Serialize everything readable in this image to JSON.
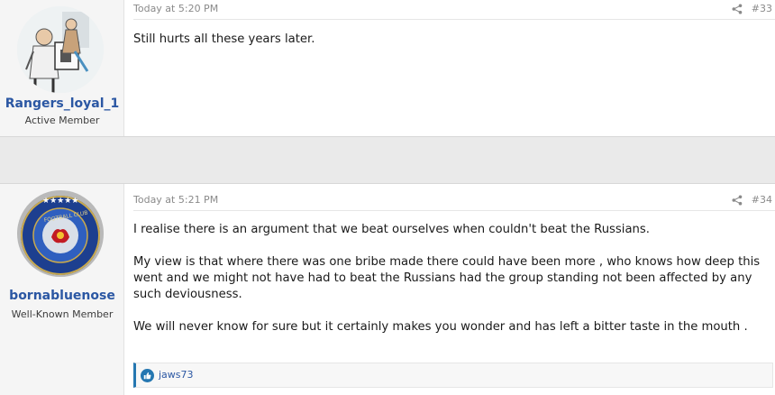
{
  "posts": [
    {
      "username": "Rangers_loyal_1",
      "user_title": "Active Member",
      "timestamp": "Today at 5:20 PM",
      "post_number": "#33",
      "paragraphs": [
        "Still hurts all these years later."
      ]
    },
    {
      "username": "bornabluenose",
      "user_title": "Well-Known Member",
      "timestamp": "Today at 5:21 PM",
      "post_number": "#34",
      "paragraphs": [
        "I realise there is an argument that we beat ourselves when couldn't beat the Russians.",
        "My view is that where there was one bribe made there could have been more , who knows how deep this went and we might not have had to beat the Russians had the group standing not been affected by any such deviousness.",
        "We will never know for sure but it certainly makes you wonder and has left a bitter taste in the mouth ."
      ],
      "reactions": {
        "icon": "like-icon",
        "users": "jaws73"
      },
      "badge_text": "FOOTBALL CLUB"
    }
  ],
  "colors": {
    "username": "#2b57a3",
    "accent": "#2577b1",
    "sidebar_bg": "#f5f5f5",
    "gap_bg": "#eaeaea"
  },
  "icons": {
    "share": "share-icon",
    "like": "like-icon"
  }
}
